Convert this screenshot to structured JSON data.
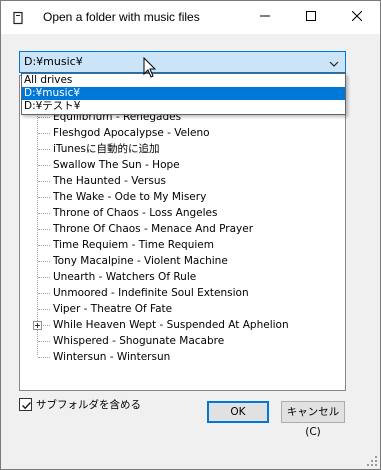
{
  "window": {
    "title": "Open a folder with music files",
    "controls": {
      "minimize": "minimize",
      "maximize": "maximize",
      "close": "close"
    }
  },
  "folder_select": {
    "selected_value": "D:¥music¥",
    "options": [
      "All drives",
      "D:¥music¥",
      "D:¥テスト¥"
    ],
    "highlighted_index": 1
  },
  "tree": {
    "items": [
      {
        "label": "Equilibrium - Renegades",
        "has_children": false
      },
      {
        "label": "Fleshgod Apocalypse - Veleno",
        "has_children": false
      },
      {
        "label": "iTunesに自動的に追加",
        "has_children": false
      },
      {
        "label": "Swallow The Sun - Hope",
        "has_children": false
      },
      {
        "label": "The Haunted - Versus",
        "has_children": false
      },
      {
        "label": "The Wake - Ode to My Misery",
        "has_children": false
      },
      {
        "label": "Throne of Chaos - Loss Angeles",
        "has_children": false
      },
      {
        "label": "Throne Of Chaos - Menace And Prayer",
        "has_children": false
      },
      {
        "label": "Time Requiem - Time Requiem",
        "has_children": false
      },
      {
        "label": "Tony Macalpine - Violent Machine",
        "has_children": false
      },
      {
        "label": "Unearth - Watchers Of Rule",
        "has_children": false
      },
      {
        "label": "Unmoored - Indefinite Soul Extension",
        "has_children": false
      },
      {
        "label": "Viper - Theatre Of Fate",
        "has_children": false
      },
      {
        "label": "While Heaven Wept - Suspended At Aphelion",
        "has_children": true
      },
      {
        "label": "Whispered - Shogunate Macabre",
        "has_children": false
      },
      {
        "label": "Wintersun - Wintersun",
        "has_children": false
      }
    ]
  },
  "include_subfolders": {
    "label": "サブフォルダを含める",
    "checked": true
  },
  "buttons": {
    "ok": "OK",
    "cancel": "キャンセル(C)"
  },
  "colors": {
    "accent": "#0078d7",
    "combo_bg": "#cce4f7",
    "dialog_bg": "#f0f0f0"
  }
}
